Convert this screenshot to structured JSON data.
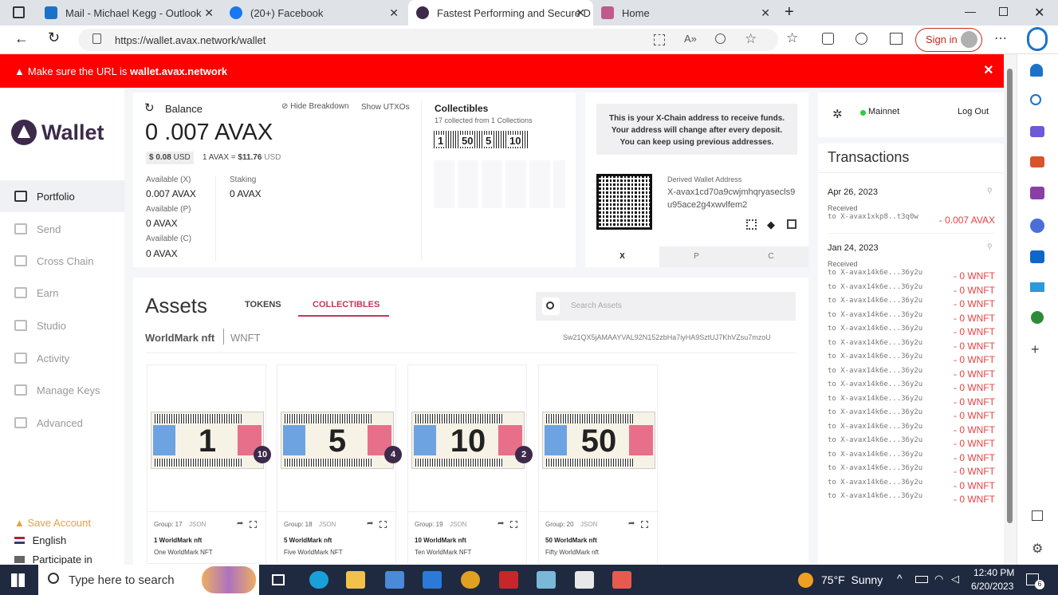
{
  "browser": {
    "tabs": [
      {
        "label": "Mail - Michael Kegg - Outlook",
        "color": "#1a73c8"
      },
      {
        "label": "(20+) Facebook",
        "color": "#1877f2"
      },
      {
        "label": "Fastest Performing and Secure D",
        "color": "#3d2a4b"
      },
      {
        "label": "Home",
        "color": "#c05a8a"
      }
    ],
    "url": "https://wallet.avax.network/wallet",
    "sign_in": "Sign in"
  },
  "banner": {
    "prefix": "Make sure the URL is ",
    "domain": "wallet.avax.network",
    "close": "×"
  },
  "nav": {
    "logo": "Wallet",
    "items": [
      "Portfolio",
      "Send",
      "Cross Chain",
      "Earn",
      "Studio",
      "Activity",
      "Manage Keys",
      "Advanced"
    ],
    "save_account": "Save Account",
    "language": "English",
    "participate": "Participate in"
  },
  "balance": {
    "title": "Balance",
    "hide": "Hide Breakdown",
    "show_utxos": "Show UTXOs",
    "big": "0",
    "decimal": ".007 AVAX",
    "usd": "$ 0.08",
    "usd_unit": "USD",
    "rate": "1 AVAX = ",
    "rate_value": "$11.76",
    "rate_unit": " USD",
    "available_x_label": "Available (X)",
    "available_x": "0.007 AVAX",
    "available_p_label": "Available (P)",
    "available_p": "0 AVAX",
    "available_c_label": "Available (C)",
    "available_c": "0 AVAX",
    "staking_label": "Staking",
    "staking": "0 AVAX"
  },
  "collectibles": {
    "title": "Collectibles",
    "sub": "17 collected from 1 Collections",
    "tickets": [
      "1",
      "50",
      "5",
      "10"
    ]
  },
  "address": {
    "note1": "This is your X-Chain address to receive funds.",
    "note2": "Your address will change after every deposit.",
    "note3": "You can keep using previous addresses.",
    "derived_label": "Derived Wallet Address",
    "address": "X-avax1cd70a9cwjmhqryasecls9u95ace2g4xwvlfem2",
    "chains": [
      "X",
      "P",
      "C"
    ]
  },
  "network": {
    "name": "Mainnet",
    "logout": "Log Out"
  },
  "transactions": {
    "title": "Transactions",
    "groups": [
      {
        "date": "Apr 26, 2023",
        "label": "Received",
        "rows": [
          {
            "to": "to X-avax1xkp8..t3q0w",
            "amt": "- 0.007 AVAX"
          }
        ]
      },
      {
        "date": "Jan 24, 2023",
        "label": "Received",
        "rows": [
          {
            "to": "to X-avax14k6e...36y2u",
            "amt": "- 0 WNFT"
          },
          {
            "to": "to X-avax14k6e...36y2u",
            "amt": "- 0 WNFT"
          },
          {
            "to": "to X-avax14k6e...36y2u",
            "amt": "- 0 WNFT"
          },
          {
            "to": "to X-avax14k6e...36y2u",
            "amt": "- 0 WNFT"
          },
          {
            "to": "to X-avax14k6e...36y2u",
            "amt": "- 0 WNFT"
          },
          {
            "to": "to X-avax14k6e...36y2u",
            "amt": "- 0 WNFT"
          },
          {
            "to": "to X-avax14k6e...36y2u",
            "amt": "- 0 WNFT"
          },
          {
            "to": "to X-avax14k6e...36y2u",
            "amt": "- 0 WNFT"
          },
          {
            "to": "to X-avax14k6e...36y2u",
            "amt": "- 0 WNFT"
          },
          {
            "to": "to X-avax14k6e...36y2u",
            "amt": "- 0 WNFT"
          },
          {
            "to": "to X-avax14k6e...36y2u",
            "amt": "- 0 WNFT"
          },
          {
            "to": "to X-avax14k6e...36y2u",
            "amt": "- 0 WNFT"
          },
          {
            "to": "to X-avax14k6e...36y2u",
            "amt": "- 0 WNFT"
          },
          {
            "to": "to X-avax14k6e...36y2u",
            "amt": "- 0 WNFT"
          },
          {
            "to": "to X-avax14k6e...36y2u",
            "amt": "- 0 WNFT"
          },
          {
            "to": "to X-avax14k6e...36y2u",
            "amt": "- 0 WNFT"
          },
          {
            "to": "to X-avax14k6e...36y2u",
            "amt": "- 0 WNFT"
          }
        ]
      }
    ]
  },
  "assets": {
    "title": "Assets",
    "tabs": [
      "TOKENS",
      "COLLECTIBLES"
    ],
    "search_placeholder": "Search Assets",
    "collection_name": "WorldMark nft",
    "collection_symbol": "WNFT",
    "collection_id": "Sw21QX5jAMAAYVAL92N152zbHa7iyHA9SztUJ7KhVZsu7mzoU",
    "nfts": [
      {
        "count": "10",
        "num": "1",
        "group": "Group: 17",
        "json": "JSON",
        "name": "1 WorldMark nft",
        "desc": "One WorldMark NFT"
      },
      {
        "count": "4",
        "num": "5",
        "group": "Group: 18",
        "json": "JSON",
        "name": "5 WorldMark nft",
        "desc": "Five WorldMark NFT"
      },
      {
        "count": "2",
        "num": "10",
        "group": "Group: 19",
        "json": "JSON",
        "name": "10 WorldMark nft",
        "desc": "Ten WorldMark NFT"
      },
      {
        "count": "",
        "num": "50",
        "group": "Group: 20",
        "json": "JSON",
        "name": "50 WorldMark nft",
        "desc": "Fifty WorldMark nft"
      }
    ]
  },
  "taskbar": {
    "search": "Type here to search",
    "weather": "75°F  Sunny",
    "time": "12:40 PM",
    "date": "6/20/2023",
    "notif": "6"
  },
  "colors": {
    "avax_red": "#e84142",
    "brand": "#3d2a4b",
    "pink": "#c0395a"
  }
}
